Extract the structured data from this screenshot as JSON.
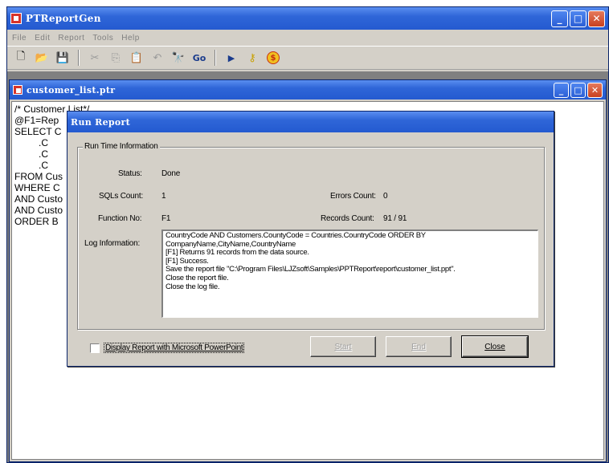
{
  "app": {
    "title": "PTReportGen",
    "menu": [
      "File",
      "Edit",
      "Report",
      "Tools",
      "Help"
    ]
  },
  "child": {
    "title": "customer_list.ptr",
    "editor_lines": [
      "/* Customer List*/",
      "@F1=Rep",
      "SELECT C",
      "         .C",
      "         .C",
      "         .C",
      "FROM Cus",
      "WHERE C",
      "AND Custo",
      "AND Custo",
      "ORDER B"
    ]
  },
  "dialog": {
    "title": "Run Report",
    "group_label": "Run Time Information",
    "status_label": "Status:",
    "status_value": "Done",
    "sqls_label": "SQLs Count:",
    "sqls_value": "1",
    "errors_label": "Errors Count:",
    "errors_value": "0",
    "function_label": "Function No:",
    "function_value": "F1",
    "records_label": "Records Count:",
    "records_value": "91 / 91",
    "log_label": "Log Information:",
    "log_lines": [
      "CountryCode AND Customers.CountyCode = Countries.CountryCode ORDER BY",
      "CompanyName,CityName,CountryName",
      "[F1]    Returns 91 records from the data source.",
      "[F1]    Success.",
      "Save the report file \"C:\\Program Files\\LJZsoft\\Samples\\PPTReport\\report\\customer_list.ppt\".",
      "Close the report file.",
      "Close the log file."
    ],
    "checkbox_label": "Display Report with Microsoft PowerPoint",
    "checkbox_checked": false,
    "start_label": "Start",
    "end_label": "End",
    "close_label": "Close"
  }
}
